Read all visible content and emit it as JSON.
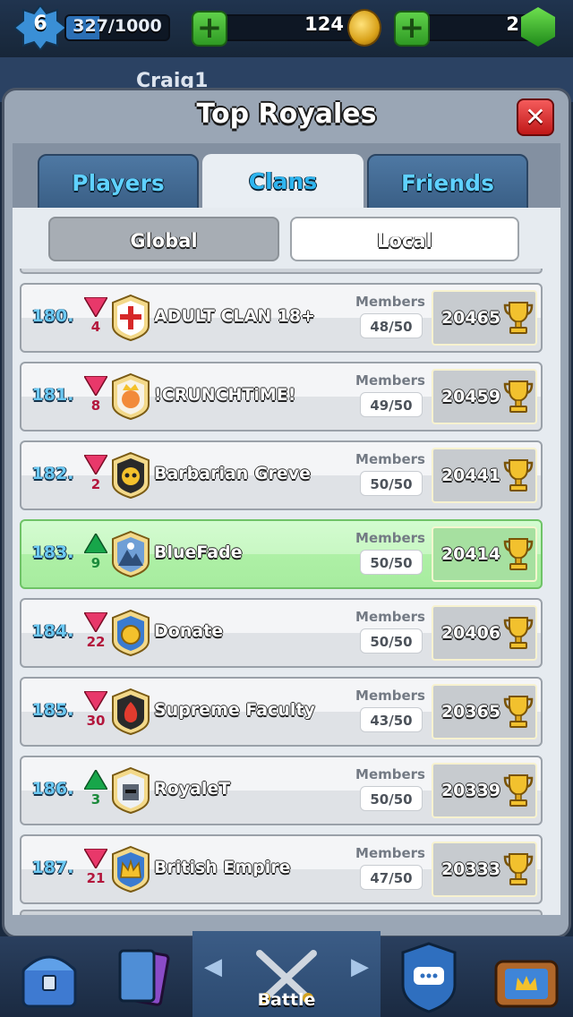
{
  "topbar": {
    "level": "6",
    "xp": "327/1000",
    "xp_progress": 0.327,
    "gold": "124",
    "gems": "2",
    "plus_symbol": "+"
  },
  "background": {
    "player_name": "Craig1"
  },
  "modal": {
    "title": "Top Royales",
    "close_symbol": "✕",
    "tabs": [
      {
        "label": "Players",
        "active": false
      },
      {
        "label": "Clans",
        "active": true
      },
      {
        "label": "Friends",
        "active": false
      }
    ],
    "scope": {
      "global": "Global",
      "local": "Local",
      "selected": "global"
    },
    "members_label": "Members",
    "rows": [
      {
        "rank": "180.",
        "direction": "down",
        "change": "4",
        "name": "ADULT CLAN 18+",
        "members": "48/50",
        "trophies": "20465",
        "badge": "red-cross-badge",
        "highlight": false
      },
      {
        "rank": "181.",
        "direction": "down",
        "change": "8",
        "name": "!CRUNCHTiME!",
        "members": "49/50",
        "trophies": "20459",
        "badge": "king-face-badge",
        "highlight": false
      },
      {
        "rank": "182.",
        "direction": "down",
        "change": "2",
        "name": "Barbarian Greve",
        "members": "50/50",
        "trophies": "20441",
        "badge": "skull-badge",
        "highlight": false
      },
      {
        "rank": "183.",
        "direction": "up",
        "change": "9",
        "name": "BlueFade",
        "members": "50/50",
        "trophies": "20414",
        "badge": "mountain-badge",
        "highlight": true
      },
      {
        "rank": "184.",
        "direction": "down",
        "change": "22",
        "name": "Donate",
        "members": "50/50",
        "trophies": "20406",
        "badge": "gold-coin-badge",
        "highlight": false
      },
      {
        "rank": "185.",
        "direction": "down",
        "change": "30",
        "name": "Supreme Faculty",
        "members": "43/50",
        "trophies": "20365",
        "badge": "flame-badge",
        "highlight": false
      },
      {
        "rank": "186.",
        "direction": "up",
        "change": "3",
        "name": "RoyaleT",
        "members": "50/50",
        "trophies": "20339",
        "badge": "knight-helmet-badge",
        "highlight": false
      },
      {
        "rank": "187.",
        "direction": "down",
        "change": "21",
        "name": "British Empire",
        "members": "47/50",
        "trophies": "20333",
        "badge": "crown-badge",
        "highlight": false
      }
    ]
  },
  "bottom_nav": {
    "battle_label": "Battle",
    "prev_symbol": "◀",
    "next_symbol": "▶"
  },
  "colors": {
    "up": "#17a64a",
    "down": "#e8386a",
    "down_text": "#b3163c",
    "up_text": "#1b8a3b",
    "highlight": "#b6f2ae"
  },
  "icons": [
    "level-star-icon",
    "gold-coin-icon",
    "gem-icon",
    "trophy-icon",
    "chest-icon",
    "cards-icon",
    "crossed-swords-icon",
    "clan-chat-icon",
    "tv-royale-icon"
  ]
}
